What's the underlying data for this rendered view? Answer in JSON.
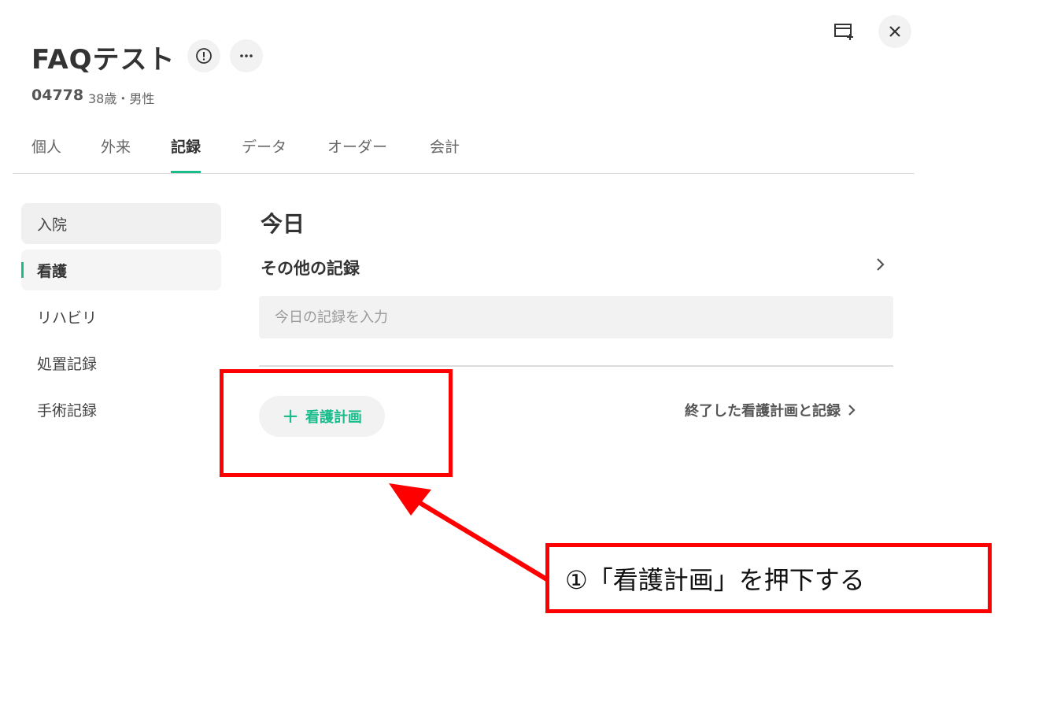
{
  "header": {
    "title": "FAQテスト",
    "patient_id": "04778",
    "patient_meta": "38歳・男性"
  },
  "tabs": [
    {
      "label": "個人",
      "active": false
    },
    {
      "label": "外来",
      "active": false
    },
    {
      "label": "記録",
      "active": true
    },
    {
      "label": "データ",
      "active": false
    },
    {
      "label": "オーダー",
      "active": false
    },
    {
      "label": "会計",
      "active": false
    }
  ],
  "sidebar": {
    "items": [
      {
        "label": "入院"
      },
      {
        "label": "看護"
      },
      {
        "label": "リハビリ"
      },
      {
        "label": "処置記録"
      },
      {
        "label": "手術記録"
      }
    ]
  },
  "main": {
    "section_title": "今日",
    "other_records_label": "その他の記録",
    "record_input_placeholder": "今日の記録を入力",
    "add_plan_label": "看護計画",
    "finished_link_label": "終了した看護計画と記録"
  },
  "annotation": {
    "callout_text": "①「看護計画」を押下する"
  },
  "colors": {
    "accent": "#1abc8c",
    "annotation": "#ff0000"
  }
}
